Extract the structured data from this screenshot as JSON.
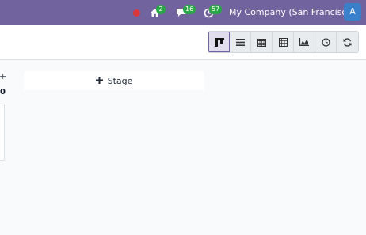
{
  "topbar": {
    "messages_badge": "2",
    "activity_badge": "16",
    "clock_badge": "57",
    "company_name": "My Company (San Francisco)",
    "avatar_initial": "A"
  },
  "view_switcher": {
    "buttons": [
      {
        "icon": "kanban-icon",
        "active": true
      },
      {
        "icon": "list-icon",
        "active": false
      },
      {
        "icon": "calendar-icon",
        "active": false
      },
      {
        "icon": "pivot-icon",
        "active": false
      },
      {
        "icon": "graph-icon",
        "active": false
      },
      {
        "icon": "activity-clock-icon",
        "active": false
      },
      {
        "icon": "refresh-icon",
        "active": false
      }
    ]
  },
  "kanban": {
    "column_edge_plus": "+",
    "column_edge_count": "0",
    "add_stage_label": "Stage"
  },
  "colors": {
    "topbar": "#71639e",
    "badge": "#28a745",
    "avatar": "#3a7fc9",
    "recording_dot": "#d9373a"
  }
}
